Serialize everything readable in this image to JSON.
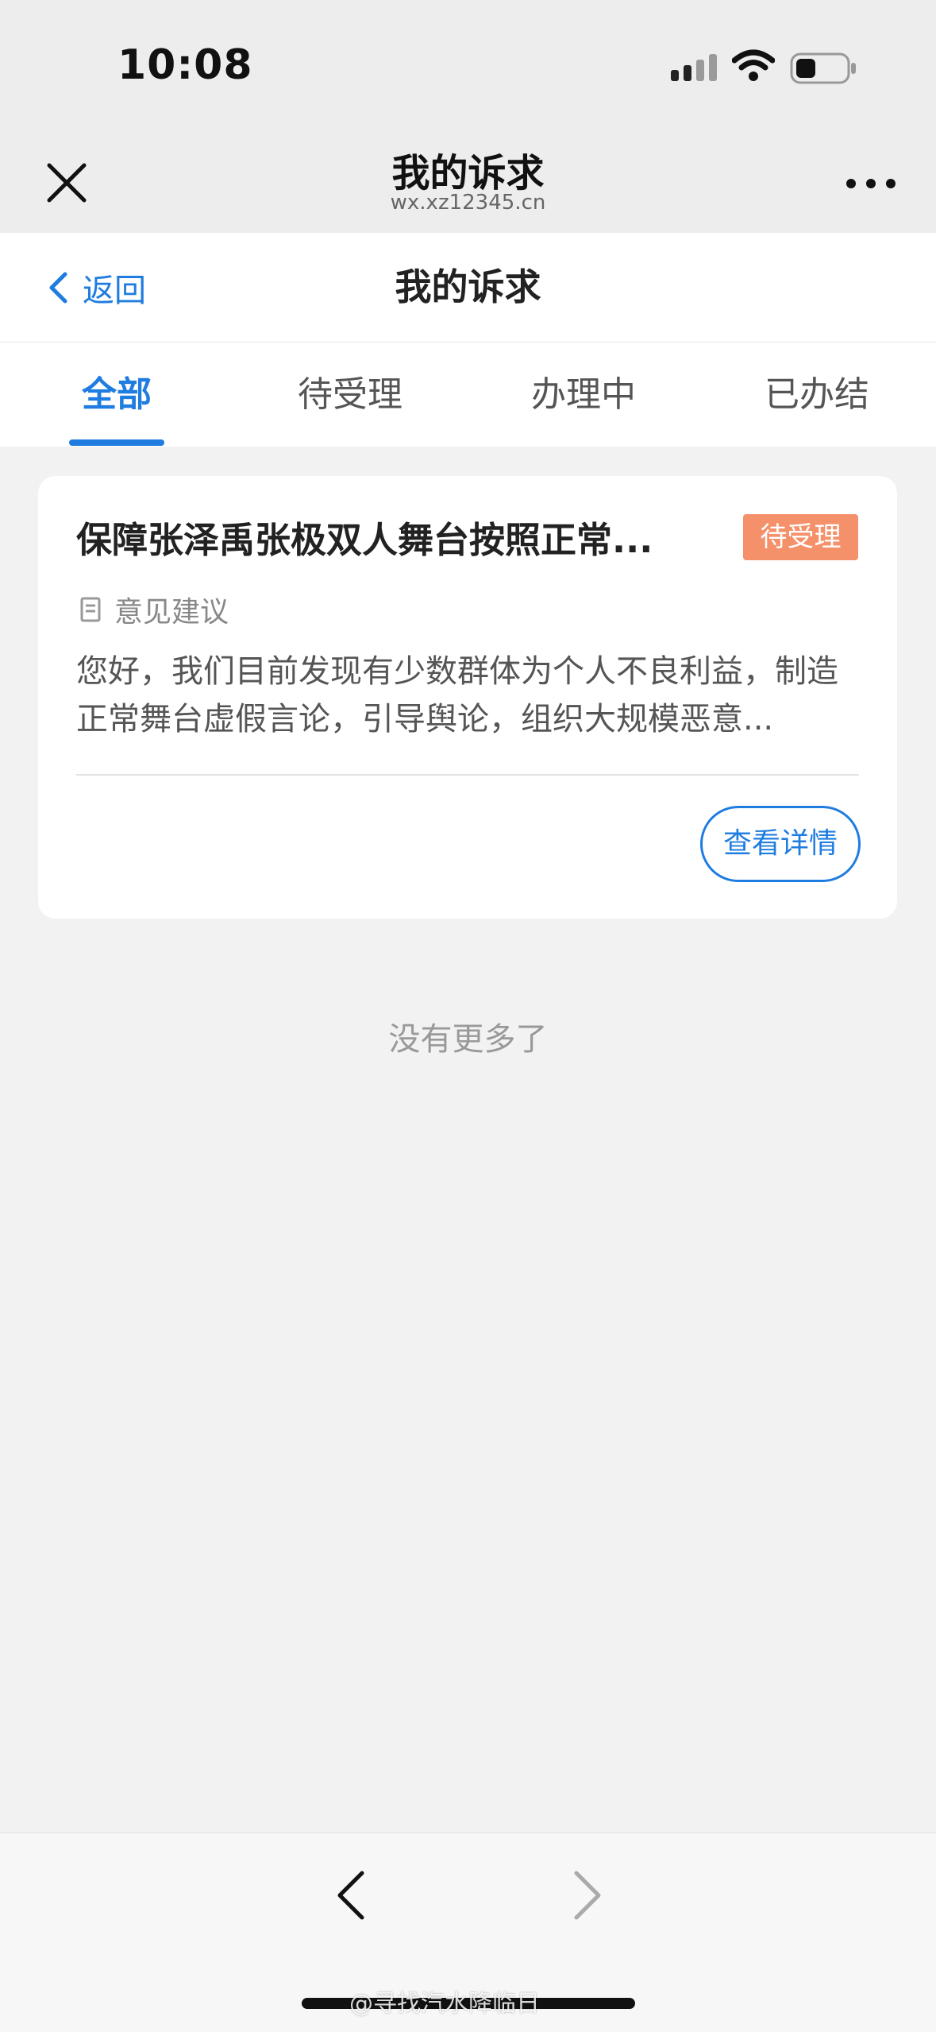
{
  "status_bar": {
    "time": "10:08"
  },
  "browser": {
    "title": "我的诉求",
    "url": "wx.xz12345.cn"
  },
  "header": {
    "back_label": "返回",
    "title": "我的诉求"
  },
  "tabs": [
    {
      "label": "全部",
      "active": true
    },
    {
      "label": "待受理",
      "active": false
    },
    {
      "label": "办理中",
      "active": false
    },
    {
      "label": "已办结",
      "active": false
    }
  ],
  "cards": [
    {
      "title": "保障张泽禹张极双人舞台按照正常...",
      "status": "待受理",
      "category": "意见建议",
      "description": "您好，我们目前发现有少数群体为个人不良利益，制造正常舞台虚假言论，引导舆论，组织大规模恶意...",
      "detail_button": "查看详情"
    }
  ],
  "no_more_text": "没有更多了",
  "watermark": "@寻找汽水降临日",
  "colors": {
    "accent": "#1f7ce0",
    "badge": "#f5916a",
    "background": "#f2f2f3"
  }
}
